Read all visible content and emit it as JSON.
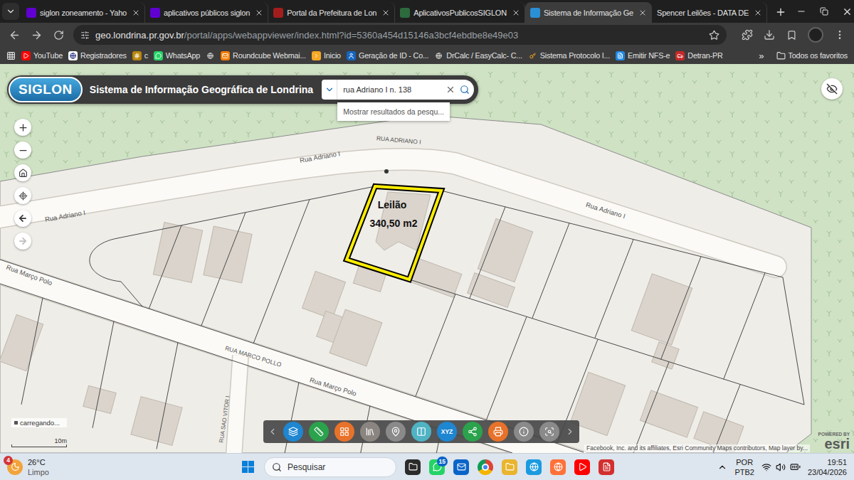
{
  "tabs": [
    {
      "label": "siglon zoneamento - Yaho",
      "selected": false
    },
    {
      "label": "aplicativos públicos siglon",
      "selected": false
    },
    {
      "label": "Portal da Prefeitura de Lon",
      "selected": false
    },
    {
      "label": "AplicativosPublicosSIGLON",
      "selected": false
    },
    {
      "label": "Sistema de Informação Ge",
      "selected": true
    },
    {
      "label": "Spencer Leilões - DATA DE",
      "selected": false
    }
  ],
  "address": {
    "host": "geo.londrina.pr.gov.br",
    "path": "/portal/apps/webappviewer/index.html?id=5360a454d15146a3bcf4ebdbe8e49e03"
  },
  "bookmarks": [
    {
      "label": "YouTube"
    },
    {
      "label": "Registradores"
    },
    {
      "label": "c"
    },
    {
      "label": "WhatsApp"
    },
    {
      "label": ""
    },
    {
      "label": "Roundcube Webmai..."
    },
    {
      "label": "Inicio"
    },
    {
      "label": "Geração de ID - Co..."
    },
    {
      "label": "DrCalc / EasyCalc- C..."
    },
    {
      "label": "Sistema Protocolo I..."
    },
    {
      "label": "Emitir NFS-e"
    },
    {
      "label": "Detran-PR"
    }
  ],
  "bookmarks_more": "»",
  "all_bookmarks": "Todos os favoritos",
  "map": {
    "logo": "SIGLON",
    "title": "Sistema de Informação Geográfica de Londrina",
    "search": {
      "value": "rua Adriano I n. 138",
      "suggestion": "Mostrar resultados da pesqu..."
    },
    "nav": {
      "back_disabled": false,
      "forward_disabled": true
    },
    "lot": {
      "label": "Leilão",
      "area": "340,50 m2"
    },
    "streets": [
      {
        "label": "RUA ADRIANO I"
      },
      {
        "label": "Rua Adriano I"
      },
      {
        "label": "Rua Adriano I"
      },
      {
        "label": "Rua Adriano I"
      },
      {
        "label": "Rua Março Polo"
      },
      {
        "label": "RUA MARCO POLLO"
      },
      {
        "label": "Rua Março Polo"
      },
      {
        "label": "RUA SAO VITOR I"
      }
    ],
    "status": "carregando...",
    "scale": "10m",
    "tools": [
      {
        "kind": "icon",
        "color": "#1f86d1"
      },
      {
        "kind": "icon",
        "color": "#2ba24c"
      },
      {
        "kind": "icon",
        "color": "#e8722a"
      },
      {
        "kind": "icon",
        "color": "#8a8580"
      },
      {
        "kind": "icon",
        "color": "#8a8a8a"
      },
      {
        "kind": "icon",
        "color": "#4fb3c4"
      },
      {
        "kind": "text",
        "color": "#1f86d1",
        "label": "XYZ"
      },
      {
        "kind": "icon",
        "color": "#2ba24c"
      },
      {
        "kind": "icon",
        "color": "#e8722a"
      },
      {
        "kind": "icon",
        "color": "#8a8a8a"
      },
      {
        "kind": "icon",
        "color": "#8a8a8a"
      }
    ],
    "attribution": "Facebook, Inc. and its affiliates, Esri Community Maps contributors, Map layer by...",
    "esri": {
      "powered": "POWERED BY",
      "name": "esri"
    }
  },
  "taskbar": {
    "weather": {
      "badge": "4",
      "temperature": "26°C",
      "condition": "Limpo"
    },
    "search": "Pesquisar",
    "whatsapp_badge": "15",
    "language": "POR",
    "layout": "PTB2",
    "time": "19:51",
    "date": "23/04/2026"
  }
}
